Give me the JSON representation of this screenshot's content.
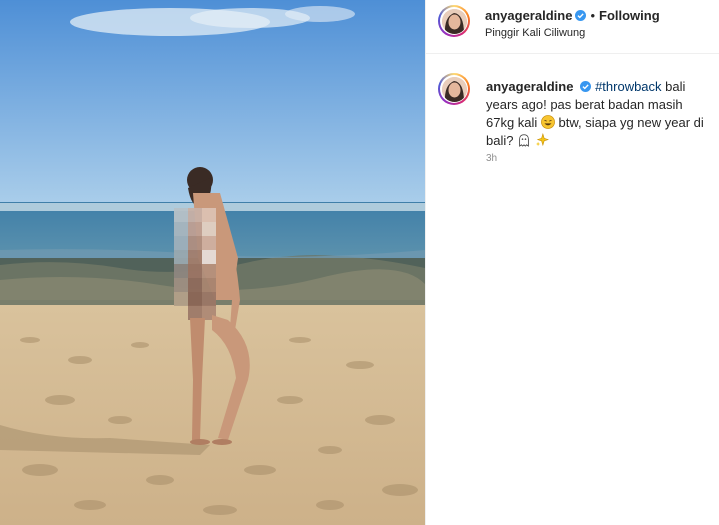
{
  "post": {
    "username": "anyageraldine",
    "following_label": "Following",
    "dot": "•",
    "location": "Pinggir Kali Ciliwung"
  },
  "caption": {
    "username": "anyageraldine",
    "hashtag": "#throwback",
    "text_part1": " bali years ago! pas berat badan masih 67kg kali ",
    "text_part2": " btw, siapa yg new year di bali? ",
    "time": "3h"
  },
  "icons": {
    "verified": "verified-badge-icon",
    "emoji1": "laughing-emoji-icon",
    "emoji2": "ghost-emoji-icon",
    "emoji3": "sparkles-emoji-icon"
  },
  "colors": {
    "verified": "#3897f0",
    "link": "#00376b",
    "muted": "#8e8e8e"
  }
}
